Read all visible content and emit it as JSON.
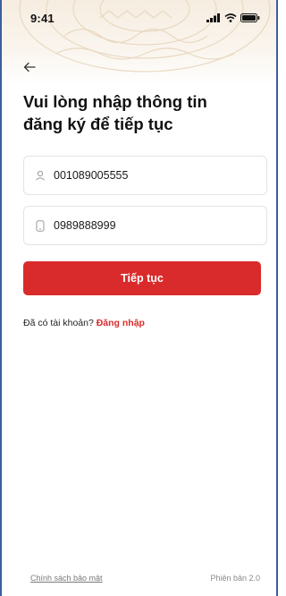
{
  "status_bar": {
    "time": "9:41"
  },
  "page": {
    "title_line1": "Vui lòng nhập thông tin",
    "title_line2": "đăng ký để tiếp tục"
  },
  "form": {
    "id_value": "001089005555",
    "phone_value": "0989888999",
    "continue_label": "Tiếp tục"
  },
  "login": {
    "prompt": "Đã có tài khoản?",
    "link": "Đăng nhập"
  },
  "footer": {
    "privacy": "Chính sách bảo mật",
    "version": "Phiên bản 2.0"
  },
  "colors": {
    "accent": "#d92b2b",
    "header_bg": "#f6ede0",
    "frame_border": "#3a5f9e"
  },
  "icons": {
    "back": "arrow-left-icon",
    "user": "user-icon",
    "phone": "phone-icon",
    "signal": "signal-icon",
    "wifi": "wifi-icon",
    "battery": "battery-icon"
  }
}
